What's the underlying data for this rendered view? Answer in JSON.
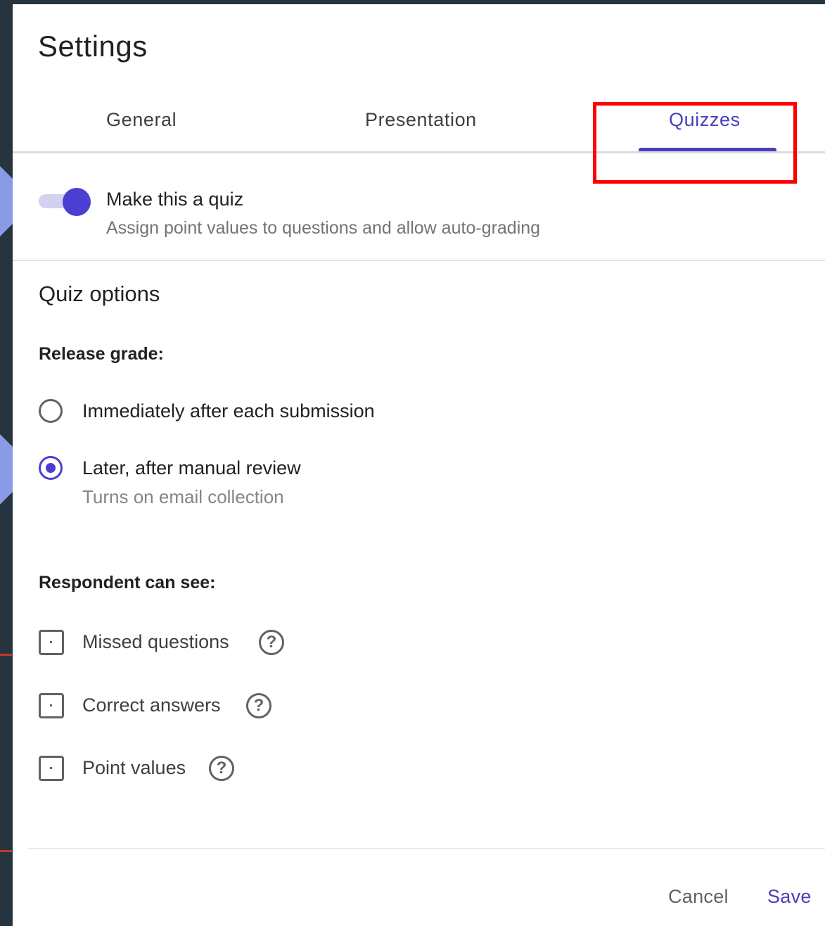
{
  "dialog": {
    "title": "Settings"
  },
  "tabs": [
    {
      "label": "General",
      "active": false
    },
    {
      "label": "Presentation",
      "active": false
    },
    {
      "label": "Quizzes",
      "active": true
    }
  ],
  "quiz_toggle": {
    "label": "Make this a quiz",
    "description": "Assign point values to questions and allow auto-grading",
    "enabled": true
  },
  "quiz_options": {
    "heading": "Quiz options",
    "release_grade": {
      "label": "Release grade:",
      "options": [
        {
          "label": "Immediately after each submission",
          "sublabel": "",
          "selected": false
        },
        {
          "label": "Later, after manual review",
          "sublabel": "Turns on email collection",
          "selected": true
        }
      ]
    },
    "respondent_can_see": {
      "label": "Respondent can see:",
      "items": [
        {
          "label": "Missed questions",
          "checked": false,
          "help": "?"
        },
        {
          "label": "Correct answers",
          "checked": false,
          "help": "?"
        },
        {
          "label": "Point values",
          "checked": false,
          "help": "?"
        }
      ]
    }
  },
  "footer": {
    "cancel_label": "Cancel",
    "save_label": "Save"
  },
  "colors": {
    "accent": "#4a3fb8",
    "highlight": "#ff0000",
    "backdrop": "#25343f",
    "pointer": "#8b9ae6"
  }
}
